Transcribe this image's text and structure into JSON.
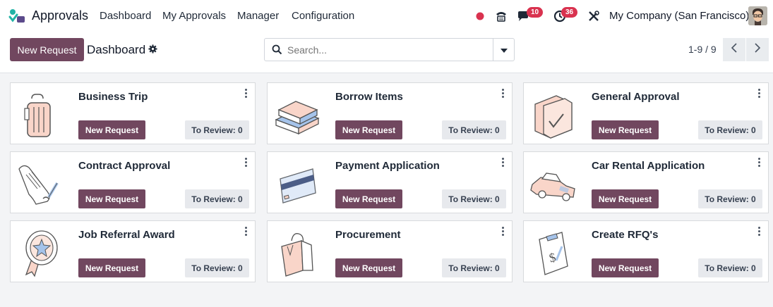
{
  "navbar": {
    "app_name": "Approvals",
    "menu": [
      "Dashboard",
      "My Approvals",
      "Manager",
      "Configuration"
    ],
    "messages_badge": "10",
    "activities_badge": "36",
    "company": "My Company (San Francisco)",
    "icons": [
      "status-dot-icon",
      "phone-icon",
      "chat-icon",
      "clock-icon",
      "tools-icon"
    ]
  },
  "control": {
    "new_button": "New Request",
    "breadcrumb": "Dashboard",
    "search_placeholder": "Search...",
    "pager": "1-9 / 9"
  },
  "cards": [
    {
      "title": "Business Trip",
      "button": "New Request",
      "review": "To Review: 0",
      "illustration": "luggage-icon"
    },
    {
      "title": "Borrow Items",
      "button": "New Request",
      "review": "To Review: 0",
      "illustration": "books-icon"
    },
    {
      "title": "General Approval",
      "button": "New Request",
      "review": "To Review: 0",
      "illustration": "folder-check-icon"
    },
    {
      "title": "Contract Approval",
      "button": "New Request",
      "review": "To Review: 0",
      "illustration": "contract-icon"
    },
    {
      "title": "Payment Application",
      "button": "New Request",
      "review": "To Review: 0",
      "illustration": "credit-card-icon"
    },
    {
      "title": "Car Rental Application",
      "button": "New Request",
      "review": "To Review: 0",
      "illustration": "car-icon"
    },
    {
      "title": "Job Referral Award",
      "button": "New Request",
      "review": "To Review: 0",
      "illustration": "award-ribbon-icon"
    },
    {
      "title": "Procurement",
      "button": "New Request",
      "review": "To Review: 0",
      "illustration": "shopping-bag-icon"
    },
    {
      "title": "Create RFQ's",
      "button": "New Request",
      "review": "To Review: 0",
      "illustration": "clipboard-dollar-icon"
    }
  ],
  "colors": {
    "primary": "#71475f",
    "badge": "#d9324f",
    "status_dot": "#d9324f",
    "illustration_fill": "#f9d5c9",
    "illustration_accent": "#a5c3ea"
  }
}
